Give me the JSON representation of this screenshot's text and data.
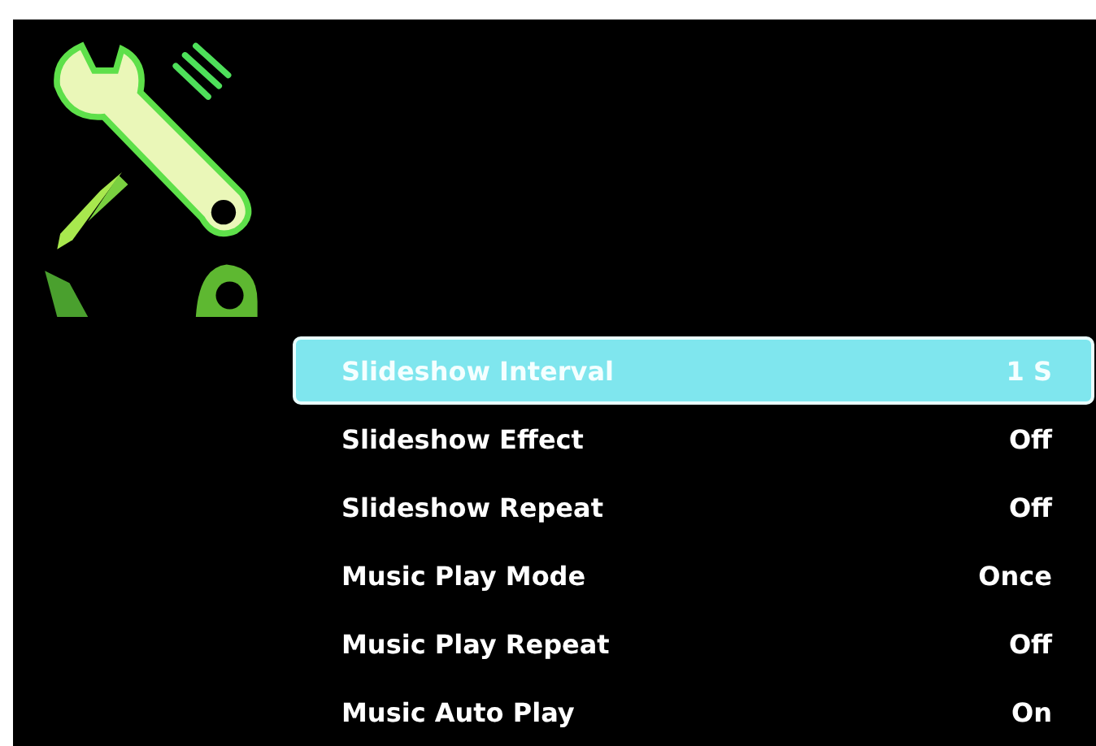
{
  "menu": {
    "items": [
      {
        "label": "Slideshow Interval",
        "value": "1 S",
        "selected": true
      },
      {
        "label": "Slideshow Effect",
        "value": "Off",
        "selected": false
      },
      {
        "label": "Slideshow Repeat",
        "value": "Off",
        "selected": false
      },
      {
        "label": "Music Play Mode",
        "value": "Once",
        "selected": false
      },
      {
        "label": "Music Play Repeat",
        "value": "Off",
        "selected": false
      },
      {
        "label": "Music Auto Play",
        "value": "On",
        "selected": false
      }
    ]
  }
}
